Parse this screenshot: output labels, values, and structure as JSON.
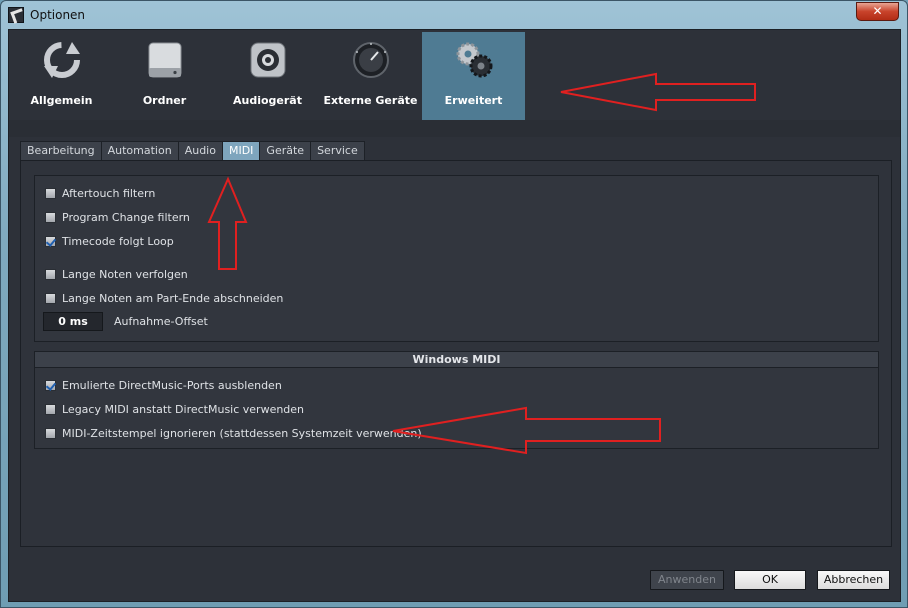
{
  "window": {
    "title": "Optionen",
    "close_label": "✕"
  },
  "categories": [
    {
      "label": "Allgemein",
      "icon": "refresh-icon"
    },
    {
      "label": "Ordner",
      "icon": "drive-icon"
    },
    {
      "label": "Audiogerät",
      "icon": "speaker-icon"
    },
    {
      "label": "Externe Geräte",
      "icon": "knob-icon"
    },
    {
      "label": "Erweitert",
      "icon": "gears-icon",
      "active": true
    }
  ],
  "tabs": [
    {
      "label": "Bearbeitung"
    },
    {
      "label": "Automation"
    },
    {
      "label": "Audio"
    },
    {
      "label": "MIDI",
      "active": true
    },
    {
      "label": "Geräte"
    },
    {
      "label": "Service"
    }
  ],
  "midi": {
    "options": [
      {
        "label": "Aftertouch filtern",
        "checked": false
      },
      {
        "label": "Program Change filtern",
        "checked": false
      },
      {
        "label": "Timecode folgt Loop",
        "checked": true
      },
      {
        "label": "Lange Noten verfolgen",
        "checked": false
      },
      {
        "label": "Lange Noten am Part-Ende abschneiden",
        "checked": false
      }
    ],
    "offset_value": "0 ms",
    "offset_label": "Aufnahme-Offset"
  },
  "windows_midi": {
    "header": "Windows MIDI",
    "options": [
      {
        "label": "Emulierte DirectMusic-Ports ausblenden",
        "checked": true
      },
      {
        "label": "Legacy MIDI anstatt DirectMusic verwenden",
        "checked": false
      },
      {
        "label": "MIDI-Zeitstempel ignorieren (stattdessen Systemzeit verwenden)",
        "checked": false
      }
    ]
  },
  "buttons": {
    "apply": "Anwenden",
    "ok": "OK",
    "cancel": "Abbrechen"
  },
  "colors": {
    "active_category": "#4f7b93",
    "active_tab": "#7ea5bd",
    "annotation": "#e02020",
    "checkmark": "#1f5fb0"
  }
}
